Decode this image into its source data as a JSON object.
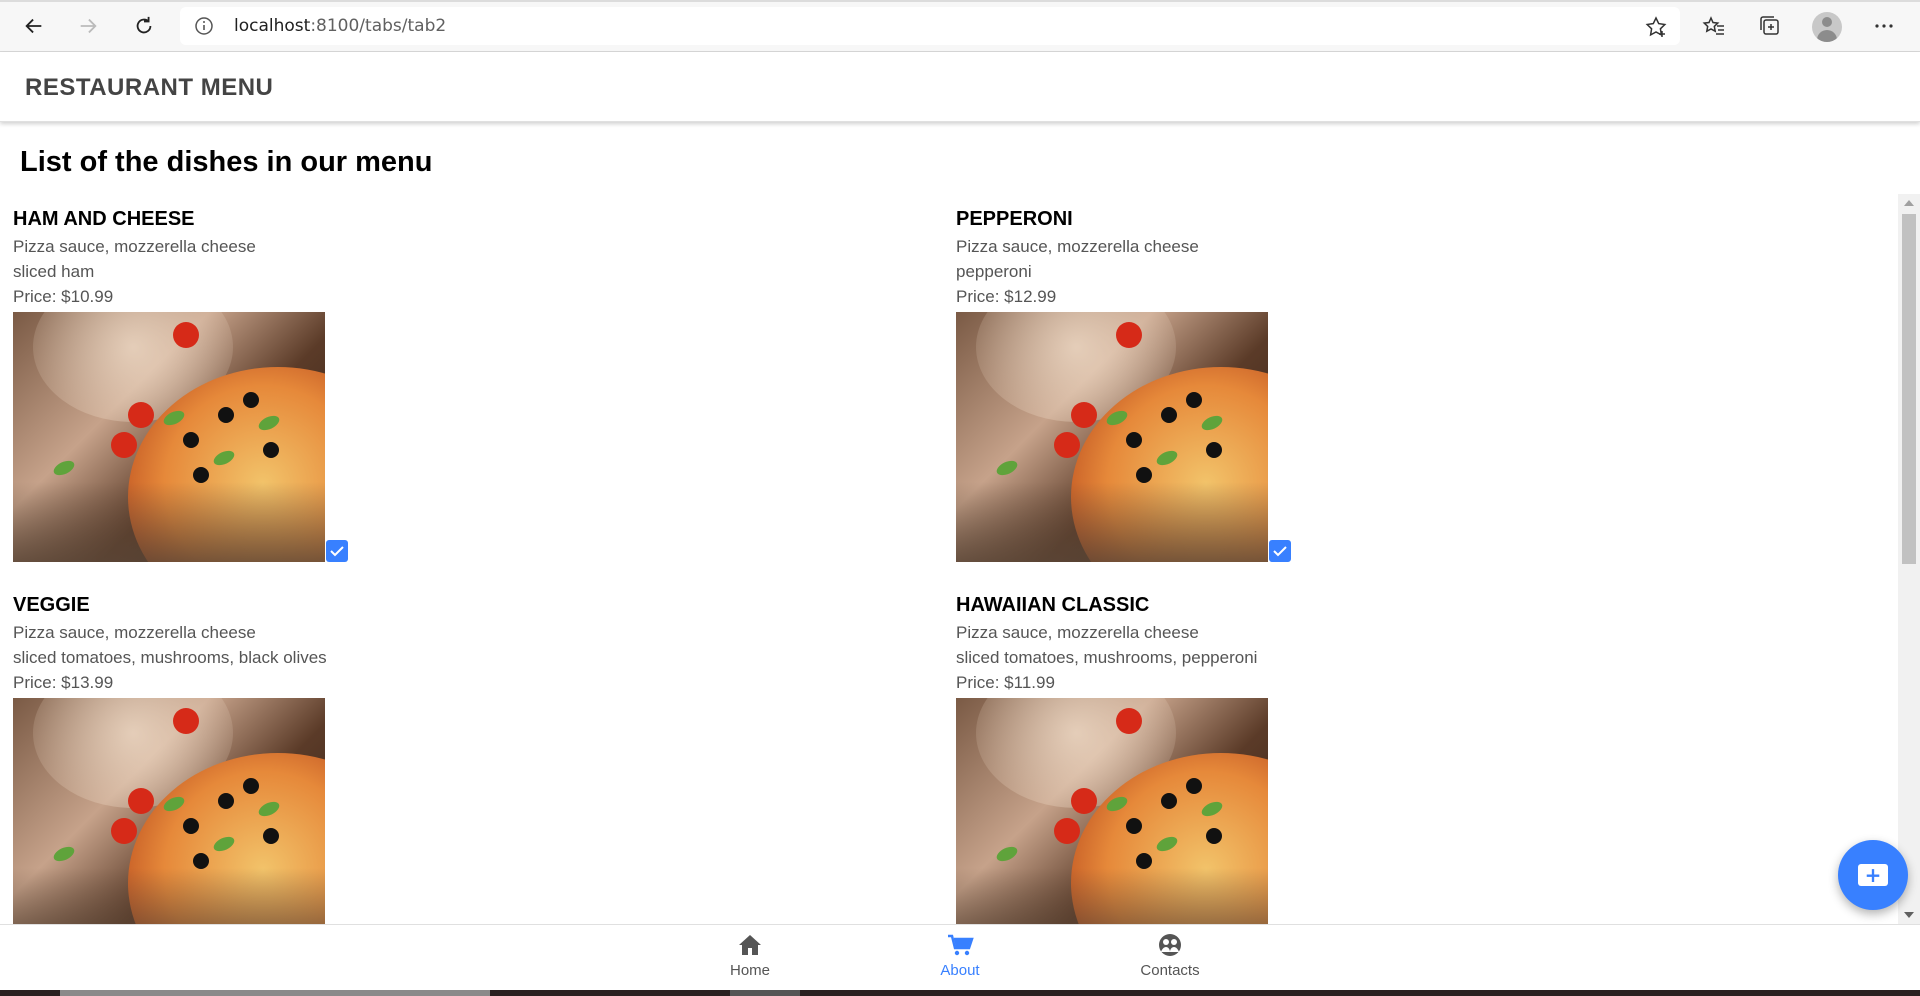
{
  "browser": {
    "url_host": "localhost",
    "url_rest": ":8100/tabs/tab2"
  },
  "app": {
    "title": "RESTAURANT MENU",
    "page_title": "List of the dishes in our menu"
  },
  "dishes": [
    {
      "name": "HAM AND CHEESE",
      "line1": "Pizza sauce, mozzerella cheese",
      "line2": "sliced ham",
      "price": "Price: $10.99",
      "checked": true
    },
    {
      "name": "PEPPERONI",
      "line1": "Pizza sauce, mozzerella cheese",
      "line2": "pepperoni",
      "price": "Price: $12.99",
      "checked": true
    },
    {
      "name": "VEGGIE",
      "line1": "Pizza sauce, mozzerella cheese",
      "line2": "sliced tomatoes, mushrooms, black olives",
      "price": "Price: $13.99",
      "checked": false
    },
    {
      "name": "HAWAIIAN CLASSIC",
      "line1": "Pizza sauce, mozzerella cheese",
      "line2": "sliced tomatoes, mushrooms, pepperoni",
      "price": "Price: $11.99",
      "checked": false
    }
  ],
  "tabs": [
    {
      "label": "Home",
      "icon": "home-icon",
      "active": false
    },
    {
      "label": "About",
      "icon": "cart-icon",
      "active": true
    },
    {
      "label": "Contacts",
      "icon": "people-icon",
      "active": false
    }
  ],
  "colors": {
    "accent": "#3880ff",
    "tab_inactive": "#555555"
  }
}
